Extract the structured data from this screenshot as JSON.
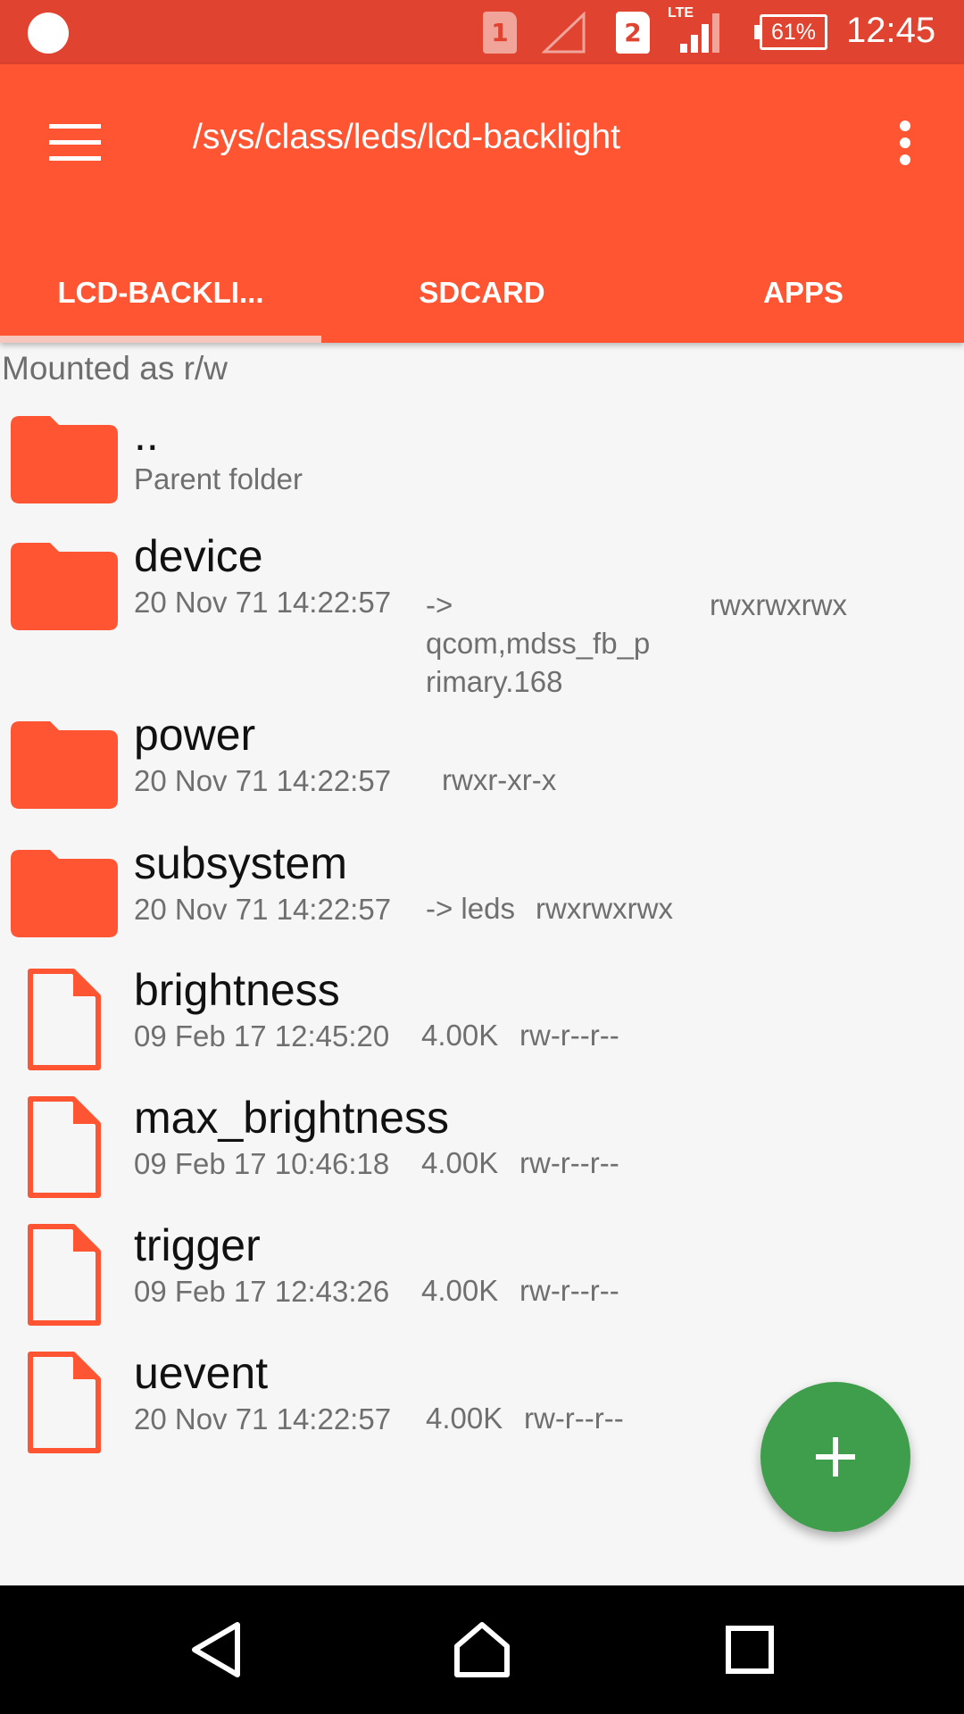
{
  "status_bar": {
    "sim1_label": "1",
    "sim2_label": "2",
    "network_type": "LTE",
    "battery": "61%",
    "time": "12:45"
  },
  "toolbar": {
    "menu_icon": "hamburger-menu-icon",
    "title": "/sys/class/leds/lcd-backlight",
    "overflow_icon": "more-vert-icon",
    "background_color": "#ff5533"
  },
  "tabs": [
    {
      "label": "LCD-BACKLI...",
      "selected": true
    },
    {
      "label": "SDCARD",
      "selected": false
    },
    {
      "label": "APPS",
      "selected": false
    }
  ],
  "mount_status": "Mounted as r/w",
  "entries": [
    {
      "type": "folder",
      "name": "..",
      "meta": "Parent folder"
    },
    {
      "type": "folder",
      "name": "device",
      "date": "20 Nov 71 14:22:57",
      "link_lines": [
        "->",
        "qcom,mdss_fb_p",
        "rimary.168"
      ],
      "permissions": "rwxrwxrwx"
    },
    {
      "type": "folder",
      "name": "power",
      "date": "20 Nov 71 14:22:57",
      "permissions": "rwxr-xr-x"
    },
    {
      "type": "folder",
      "name": "subsystem",
      "date": "20 Nov 71 14:22:57",
      "link": "-> leds",
      "permissions": "rwxrwxrwx"
    },
    {
      "type": "file",
      "name": "brightness",
      "date": "09 Feb 17 12:45:20",
      "size": "4.00K",
      "permissions": "rw-r--r--"
    },
    {
      "type": "file",
      "name": "max_brightness",
      "date": "09 Feb 17 10:46:18",
      "size": "4.00K",
      "permissions": "rw-r--r--"
    },
    {
      "type": "file",
      "name": "trigger",
      "date": "09 Feb 17 12:43:26",
      "size": "4.00K",
      "permissions": "rw-r--r--"
    },
    {
      "type": "file",
      "name": "uevent",
      "date": "20 Nov 71 14:22:57",
      "size": "4.00K",
      "permissions": "rw-r--r--"
    }
  ],
  "fab": {
    "icon": "add-icon",
    "color": "#3f9e4b"
  },
  "nav_bar": {
    "back_icon": "back-icon",
    "home_icon": "home-icon",
    "recents_icon": "recents-icon"
  },
  "colors": {
    "status_bar": "#e04330",
    "accent": "#ff5533",
    "fab": "#3f9e4b"
  }
}
